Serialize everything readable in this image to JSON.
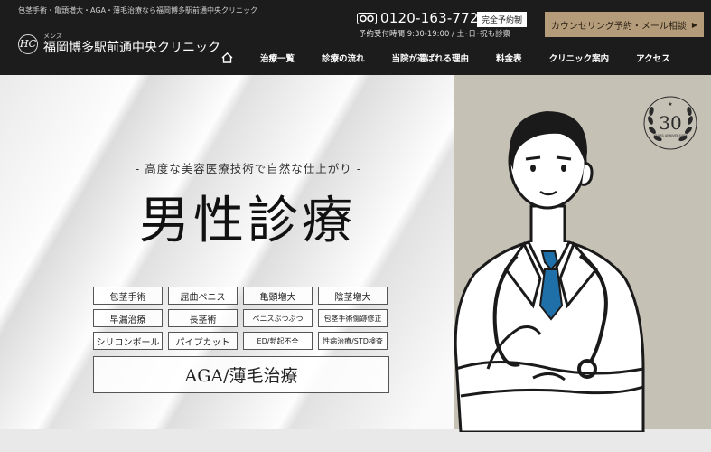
{
  "header": {
    "topline": "包茎手術・亀頭増大・AGA・薄毛治療なら福岡博多駅前通中央クリニック",
    "logo_small": "メンズ",
    "logo_name": "福岡博多駅前通中央クリニック",
    "logo_mark": "HC",
    "phone_icon": "free-dial-icon",
    "phone_number": "0120-163-772",
    "reserve_badge": "完全予約制",
    "hours": "予約受付時間  9:30-19:00  /  土･日･祝も診察",
    "cta_label": "カウンセリング予約・メール相談",
    "cta_arrow": "▶"
  },
  "nav": {
    "home_icon": "home-icon",
    "items": [
      "治療一覧",
      "診療の流れ",
      "当院が選ばれる理由",
      "料金表",
      "クリニック案内",
      "アクセス"
    ]
  },
  "hero": {
    "subtitle": "- 高度な美容医療技術で自然な仕上がり -",
    "title": "男性診療",
    "tags": [
      "包茎手術",
      "屈曲ペニス",
      "亀頭増大",
      "陰茎増大",
      "早漏治療",
      "長茎術",
      "ペニスぶつぶつ",
      "包茎手術傷跡修正",
      "シリコンボール",
      "パイプカット",
      "ED/勃起不全",
      "性病治療/STD検査"
    ],
    "tag_wide": "AGA/薄毛治療",
    "badge_number": "30",
    "badge_text": "YEARS ANNIVERSARY"
  },
  "colors": {
    "header_bg": "#1c1c1c",
    "cta_bg": "#b49b79",
    "hero_panel": "#c6c1b5",
    "tie": "#1f6fa8"
  }
}
